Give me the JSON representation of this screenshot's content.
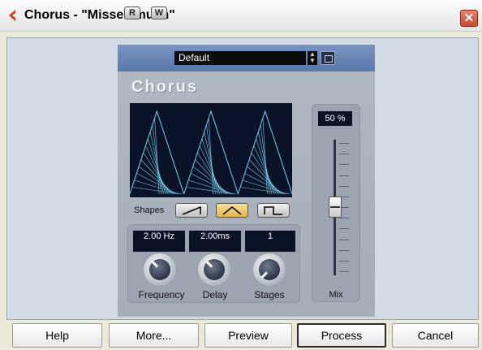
{
  "window": {
    "title": "Chorus - \"Misses much\"",
    "close_glyph": "✕",
    "logo_icon": "cubase-logo-icon",
    "close_color": "#d35c42"
  },
  "preset_bar": {
    "read_label": "R",
    "write_label": "W",
    "preset_name": "Default",
    "accent": "#5f7cb4"
  },
  "plugin": {
    "name": "Chorus",
    "display_bg": "#0a1327",
    "waveform_color": "#7fd2f0",
    "shapes_label": "Shapes",
    "shapes": [
      {
        "icon": "sawtooth-shape-icon",
        "active": false
      },
      {
        "icon": "triangle-shape-icon",
        "active": true
      },
      {
        "icon": "square-shape-icon",
        "active": false
      }
    ],
    "knobs": [
      {
        "label": "Frequency",
        "value": "2.00 Hz"
      },
      {
        "label": "Delay",
        "value": "2.00ms"
      },
      {
        "label": "Stages",
        "value": "1"
      }
    ],
    "mix": {
      "label": "Mix",
      "value": "50 %",
      "level": 0.5
    }
  },
  "buttons": {
    "help": "Help",
    "more": "More...",
    "preview": "Preview",
    "process": "Process",
    "cancel": "Cancel"
  }
}
